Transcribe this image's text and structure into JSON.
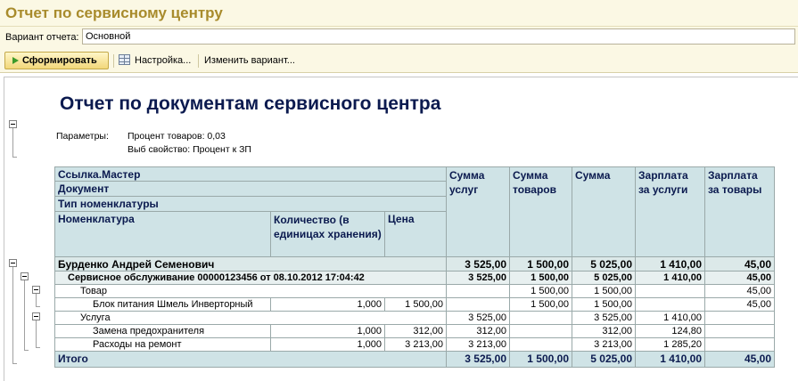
{
  "window": {
    "title": "Отчет по сервисному центру"
  },
  "variant": {
    "label": "Вариант отчета:",
    "value": "Основной"
  },
  "toolbar": {
    "generate_label": "Сформировать",
    "settings_label": "Настройка...",
    "change_variant_label": "Изменить вариант..."
  },
  "report": {
    "title": "Отчет по документам сервисного центра",
    "params_label": "Параметры:",
    "params": [
      "Процент товаров: 0,03",
      "Выб свойство: Процент к ЗП"
    ],
    "headers": {
      "master": "Ссылка.Мастер",
      "document": "Документ",
      "nomenclature_type": "Тип номенклатуры",
      "nomenclature": "Номенклатура",
      "quantity": "Количество (в единицах хранения)",
      "price": "Цена",
      "sum_services": "Сумма услуг",
      "sum_goods": "Сумма товаров",
      "sum": "Сумма",
      "salary_services": "Зарплата за услуги",
      "salary_goods": "Зарплата за товары"
    },
    "rows": [
      {
        "name": "Бурденко Андрей Семенович",
        "quantity": "",
        "price": "",
        "sum_services": "3 525,00",
        "sum_goods": "1 500,00",
        "sum": "5 025,00",
        "salary_services": "1 410,00",
        "salary_goods": "45,00"
      },
      {
        "name": "Сервисное обслуживание 00000123456 от 08.10.2012 17:04:42",
        "quantity": "",
        "price": "",
        "sum_services": "3 525,00",
        "sum_goods": "1 500,00",
        "sum": "5 025,00",
        "salary_services": "1 410,00",
        "salary_goods": "45,00"
      },
      {
        "name": "Товар",
        "quantity": "",
        "price": "",
        "sum_services": "",
        "sum_goods": "1 500,00",
        "sum": "1 500,00",
        "salary_services": "",
        "salary_goods": "45,00"
      },
      {
        "name": "Блок питания Шмель Инверторный",
        "quantity": "1,000",
        "price": "1 500,00",
        "sum_services": "",
        "sum_goods": "1 500,00",
        "sum": "1 500,00",
        "salary_services": "",
        "salary_goods": "45,00"
      },
      {
        "name": "Услуга",
        "quantity": "",
        "price": "",
        "sum_services": "3 525,00",
        "sum_goods": "",
        "sum": "3 525,00",
        "salary_services": "1 410,00",
        "salary_goods": ""
      },
      {
        "name": "Замена предохранителя",
        "quantity": "1,000",
        "price": "312,00",
        "sum_services": "312,00",
        "sum_goods": "",
        "sum": "312,00",
        "salary_services": "124,80",
        "salary_goods": ""
      },
      {
        "name": "Расходы на ремонт",
        "quantity": "1,000",
        "price": "3 213,00",
        "sum_services": "3 213,00",
        "sum_goods": "",
        "sum": "3 213,00",
        "salary_services": "1 285,20",
        "salary_goods": ""
      }
    ],
    "total": {
      "label": "Итого",
      "sum_services": "3 525,00",
      "sum_goods": "1 500,00",
      "sum": "5 025,00",
      "salary_services": "1 410,00",
      "salary_goods": "45,00"
    }
  }
}
